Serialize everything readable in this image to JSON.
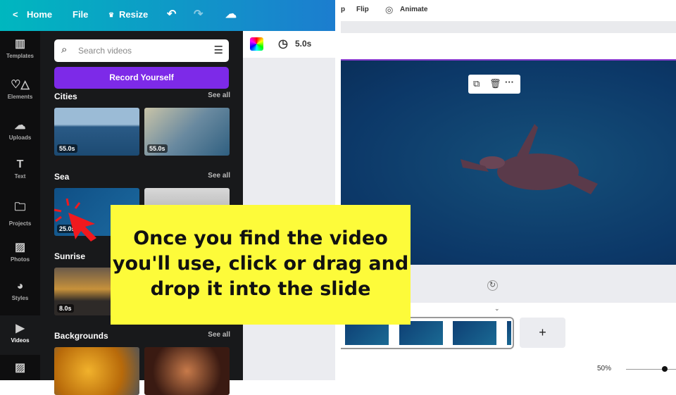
{
  "topbar": {
    "home": "Home",
    "file": "File",
    "resize": "Resize"
  },
  "rail": [
    {
      "label": "Templates",
      "icon": "▥"
    },
    {
      "label": "Elements",
      "icon": "♡△"
    },
    {
      "label": "Uploads",
      "icon": "☁"
    },
    {
      "label": "Text",
      "icon": "T"
    },
    {
      "label": "Projects",
      "icon": "🗀"
    },
    {
      "label": "Photos",
      "icon": "▨"
    },
    {
      "label": "Styles",
      "icon": "◕"
    },
    {
      "label": "Videos",
      "icon": "▶"
    },
    {
      "label": "",
      "icon": "▨"
    }
  ],
  "panel": {
    "search_placeholder": "Search videos",
    "record": "Record Yourself",
    "sections": [
      {
        "title": "Cities",
        "see_all": "See all",
        "durations": [
          "55.0s",
          "55.0s"
        ]
      },
      {
        "title": "Sea",
        "see_all": "See all",
        "durations": [
          "25.0s",
          ""
        ]
      },
      {
        "title": "Sunrise",
        "see_all": "",
        "durations": [
          "8.0s",
          ""
        ]
      },
      {
        "title": "Backgrounds",
        "see_all": "See all",
        "durations": [
          "",
          ""
        ]
      }
    ]
  },
  "mid": {
    "duration": "5.0s"
  },
  "right": {
    "crop_partial": "p",
    "flip": "Flip",
    "animate": "Animate",
    "zoom": "50%",
    "zoom_fraction": 0.5,
    "add": "+"
  },
  "callout": "Once you find the video you'll use, click or drag and drop it into the slide"
}
